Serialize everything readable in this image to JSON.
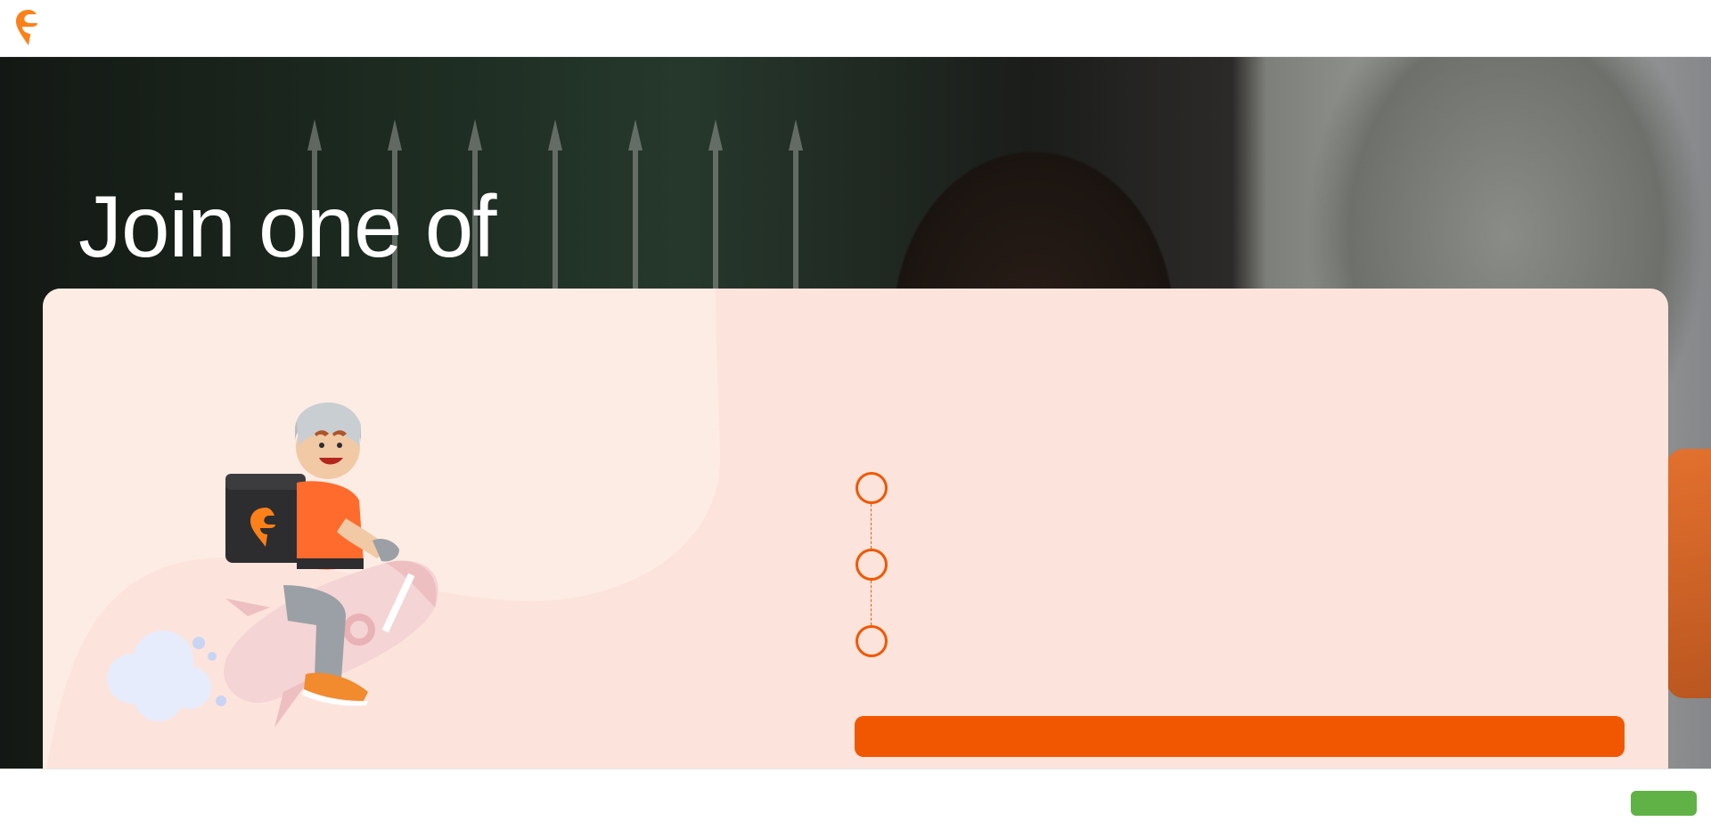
{
  "header": {
    "logo_icon": "swiggy-logo-icon",
    "logo_color": "#fc8019"
  },
  "hero": {
    "title": "Join one of"
  },
  "card": {
    "background_color": "#fce4dc",
    "illustration": "delivery-rider-on-rocket-illustration",
    "steps": [
      {
        "icon": "step-circle-icon"
      },
      {
        "icon": "step-circle-icon"
      },
      {
        "icon": "step-circle-icon"
      }
    ],
    "cta_color": "#f15700"
  },
  "footer": {
    "button_color": "#60b246"
  }
}
